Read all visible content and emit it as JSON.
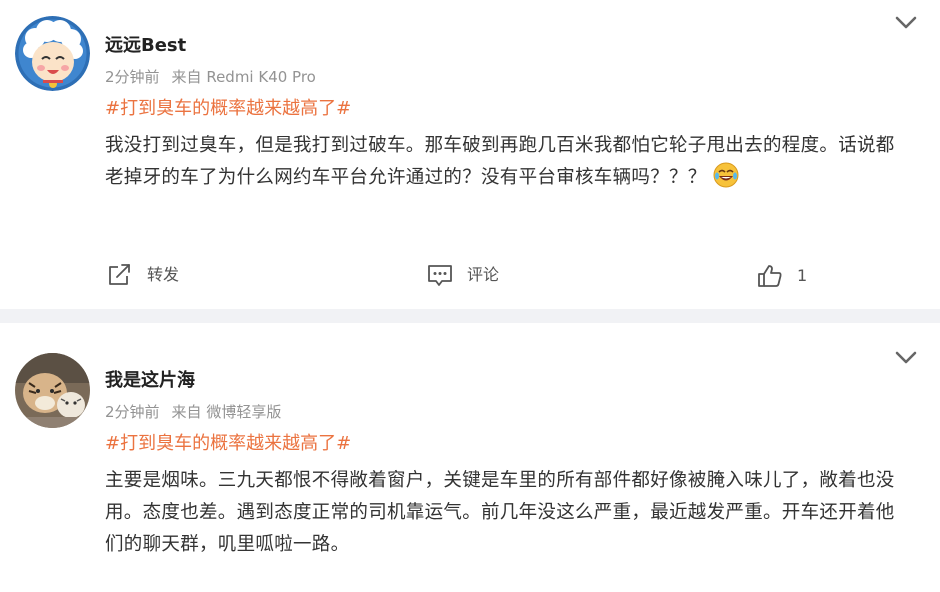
{
  "posts": [
    {
      "username": "远远Best",
      "time": "2分钟前",
      "source": "来自 Redmi K40 Pro",
      "topic": "#打到臭车的概率越来越高了#",
      "content": "我没打到过臭车，但是我打到过破车。那车破到再跑几百米我都怕它轮子甩出去的程度。话说都老掉牙的车了为什么网约车平台允许通过的？没有平台审核车辆吗？？？",
      "content_emoji": "laughing-crying-emoji",
      "avatar_icon": "pleasant-goat-avatar-icon",
      "actions": {
        "repost_label": "转发",
        "comment_label": "评论",
        "like_count": "1"
      }
    },
    {
      "username": "我是这片海",
      "time": "2分钟前",
      "source": "来自 微博轻享版",
      "topic": "#打到臭车的概率越来越高了#",
      "content": "主要是烟味。三九天都恨不得敞着窗户，关键是车里的所有部件都好像被腌入味儿了，敞着也没用。态度也差。遇到态度正常的司机靠运气。前几年没这么严重，最近越发严重。开车还开着他们的聊天群，叽里呱啦一路。",
      "avatar_icon": "white-tiger-avatar-icon"
    }
  ],
  "colors": {
    "topic": "#eb7340",
    "meta": "#939393",
    "text": "#333333",
    "divider": "#f1f2f5"
  },
  "icons": [
    "chevron-down-icon",
    "share-icon",
    "comment-icon",
    "thumbs-up-icon"
  ]
}
